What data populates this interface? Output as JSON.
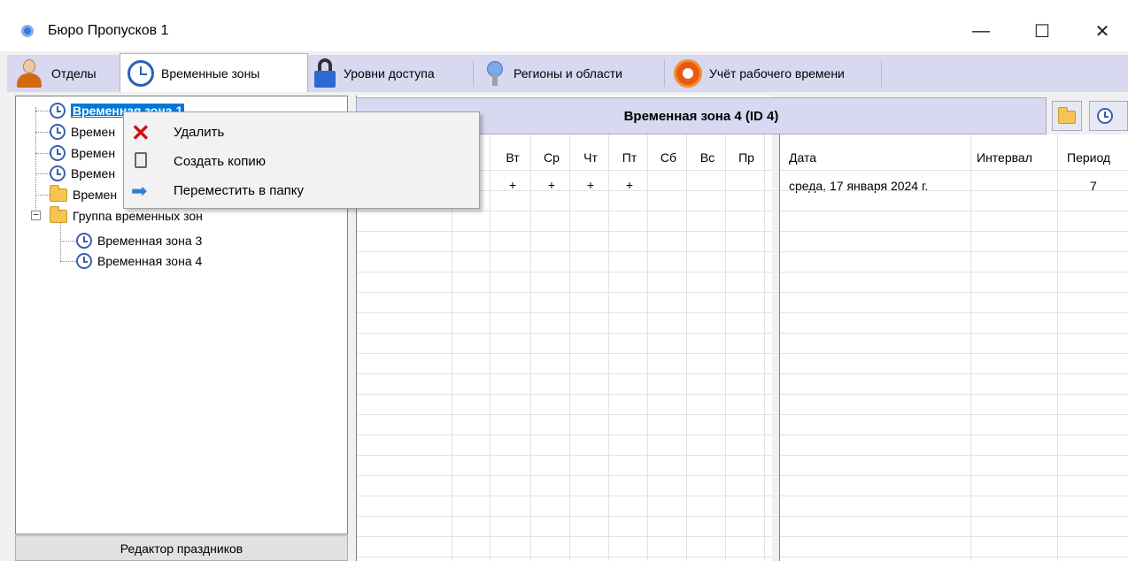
{
  "window": {
    "title": "Бюро Пропусков 1",
    "min": "—",
    "max": "☐",
    "close": "✕"
  },
  "tabs": [
    {
      "label": "Отделы"
    },
    {
      "label": "Временные зоны"
    },
    {
      "label": "Уровни доступа"
    },
    {
      "label": "Регионы и области"
    },
    {
      "label": "Учёт рабочего времени"
    }
  ],
  "tree": {
    "items": [
      {
        "label": "Временная зона 1"
      },
      {
        "label": "Времен"
      },
      {
        "label": "Времен"
      },
      {
        "label": "Времен"
      },
      {
        "label": "Времен"
      },
      {
        "label": "Группа временных зон"
      },
      {
        "label": "Временная зона 3"
      },
      {
        "label": "Временная зона 4"
      }
    ],
    "expander": "−"
  },
  "holiday_button": "Редактор праздников",
  "zone_header": "Временная зона 4 (ID 4)",
  "days": {
    "headers": [
      "Вт",
      "Ср",
      "Чт",
      "Пт",
      "Сб",
      "Вс",
      "Пр"
    ],
    "row1": [
      "+",
      "+",
      "+",
      "+",
      "",
      "",
      ""
    ]
  },
  "dates": {
    "headers": {
      "date": "Дата",
      "interval": "Интервал",
      "period": "Период"
    },
    "rows": [
      {
        "date": "среда, 17 января 2024 г.",
        "interval": "",
        "period": "7"
      }
    ]
  },
  "context_menu": {
    "items": [
      {
        "label": "Удалить",
        "icon": "delete-icon"
      },
      {
        "label": "Создать копию",
        "icon": "copy-icon"
      },
      {
        "label": "Переместить в папку",
        "icon": "move-arrow-icon"
      }
    ]
  }
}
